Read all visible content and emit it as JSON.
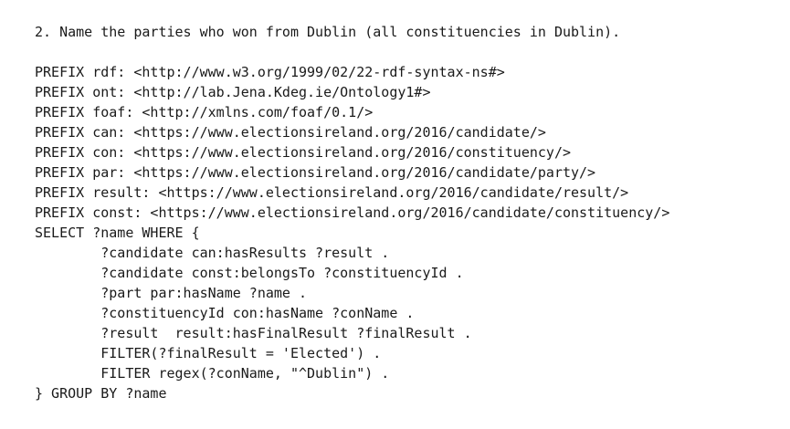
{
  "question": "2. Name the parties who won from Dublin (all constituencies in Dublin).",
  "query_lines": [
    "PREFIX rdf: <http://www.w3.org/1999/02/22-rdf-syntax-ns#>",
    "PREFIX ont: <http://lab.Jena.Kdeg.ie/Ontology1#>",
    "PREFIX foaf: <http://xmlns.com/foaf/0.1/>",
    "PREFIX can: <https://www.electionsireland.org/2016/candidate/>",
    "PREFIX con: <https://www.electionsireland.org/2016/constituency/>",
    "PREFIX par: <https://www.electionsireland.org/2016/candidate/party/>",
    "PREFIX result: <https://www.electionsireland.org/2016/candidate/result/>",
    "PREFIX const: <https://www.electionsireland.org/2016/candidate/constituency/>",
    "SELECT ?name WHERE {",
    "        ?candidate can:hasResults ?result .",
    "        ?candidate const:belongsTo ?constituencyId .",
    "        ?part par:hasName ?name .",
    "        ?constituencyId con:hasName ?conName .",
    "        ?result  result:hasFinalResult ?finalResult .",
    "        FILTER(?finalResult = 'Elected') .",
    "        FILTER regex(?conName, \"^Dublin\") .",
    "} GROUP BY ?name"
  ]
}
